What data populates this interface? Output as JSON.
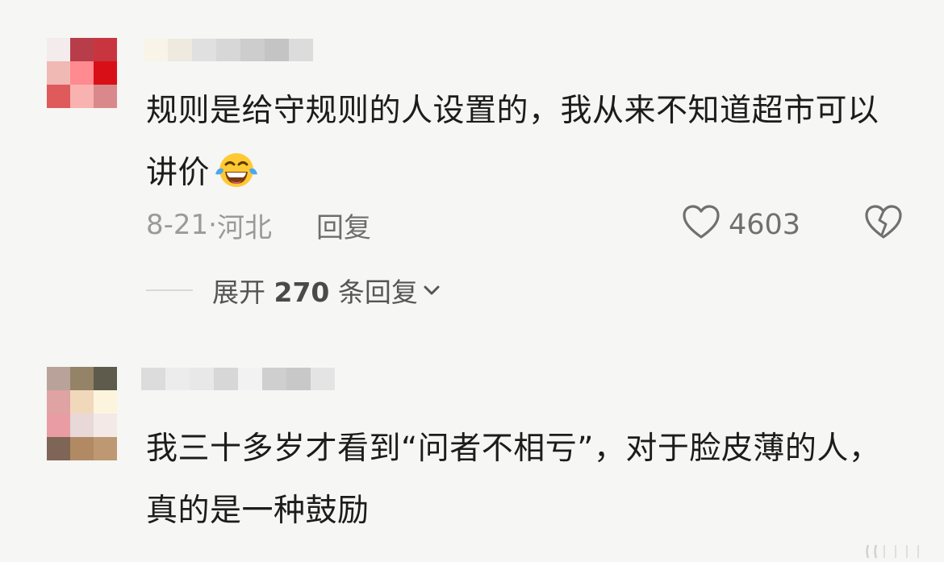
{
  "comments": [
    {
      "text": "规则是给守规则的人设置的，我从来不知道超市可以讲价",
      "emoji": "joy-tears-emoji",
      "date": "8-21",
      "location": "河北",
      "reply_label": "回复",
      "likes": "4603",
      "expand": {
        "prefix": "展开",
        "count": "270",
        "suffix": "条回复"
      }
    },
    {
      "text": "我三十多岁才看到“问者不相亏”，对于脸皮薄的人，真的是一种鼓励"
    }
  ],
  "avatars": {
    "first": [
      "#f4ecec",
      "#b73d4a",
      "#c9353f",
      "#f0b9b4",
      "#ff8a8f",
      "#d90f17",
      "#de5a5b",
      "#f8b3b1",
      "#d9898c"
    ],
    "second": [
      "#b8a29a",
      "#948366",
      "#5e5b4c",
      "#dfa3a4",
      "#f2d8bb",
      "#fdf4de",
      "#e99ca3",
      "#e8d8d8",
      "#f3e9e6",
      "#7e6556",
      "#b18a64",
      "#bd9872"
    ]
  },
  "usernames": {
    "first": [
      "#f8f4e8",
      "#eeeae0",
      "#e0e0e0",
      "#d7d7d7",
      "#cdcdcd",
      "#c4c4c4",
      "#dcdcdc"
    ],
    "second": [
      "#dcdcdc",
      "#ececec",
      "#e8e8e8",
      "#d7d7d7",
      "#f2f2f2",
      "#cfcfcf",
      "#c8c8c8",
      "#e4e4e4"
    ]
  },
  "colors": {
    "background": "#f6f6f4",
    "text": "#1c1c1c",
    "meta": "#8e8e8e",
    "icon": "#6e6e6e"
  },
  "icons": {
    "like": "heart-outline-icon",
    "dislike": "broken-heart-icon",
    "expand": "chevron-down-icon"
  }
}
